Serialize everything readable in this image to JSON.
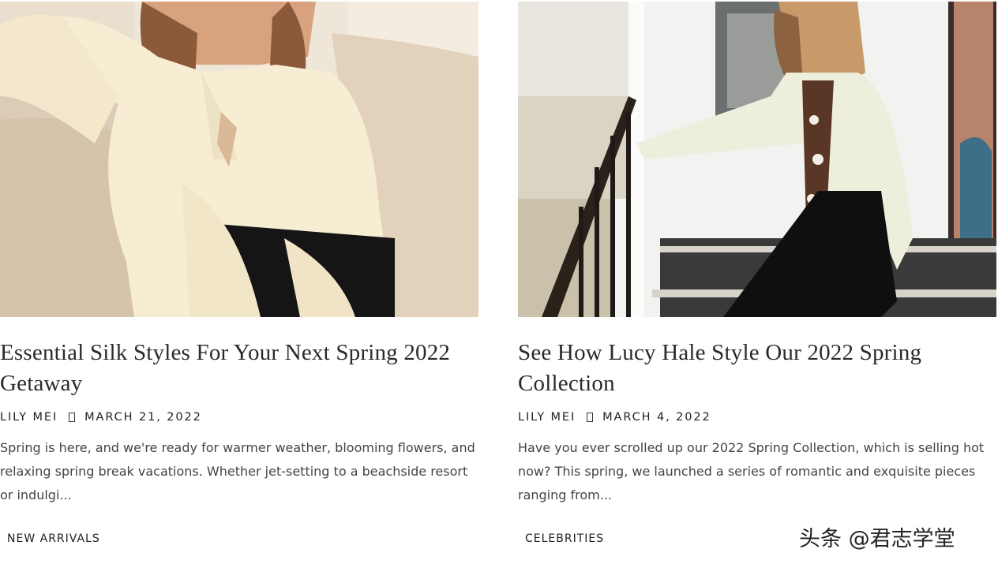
{
  "posts": [
    {
      "title": "Essential Silk Styles For Your Next Spring 2022 Getaway",
      "author": "LILY MEI",
      "date": "MARCH 21, 2022",
      "excerpt": "Spring is here, and we're ready for warmer weather, blooming flowers, and relaxing spring break vacations. Whether jet-setting to a beachside resort or indulgi...",
      "tag": "NEW ARRIVALS",
      "image_alt": "Model in a cream silk blouse seated on a beige sofa",
      "colors": {
        "background": "#efe6da",
        "sofa": "#dccbb6",
        "blouse": "#f6edd3",
        "hair": "#8a5a3a",
        "trousers": "#151515"
      }
    },
    {
      "title": "See How Lucy Hale Style Our 2022 Spring Collection",
      "author": "LILY MEI",
      "date": "MARCH 4, 2022",
      "excerpt": "Have you ever scrolled up our 2022 Spring Collection, which is selling hot now? This spring, we launched a series of romantic and exquisite pieces ranging from...",
      "tag": "CELEBRITIES",
      "image_alt": "Lucy Hale in a silk shirt with brown floral scarf on a staircase",
      "colors": {
        "wall": "#f2f2f0",
        "stairs": "#2d2d2d",
        "shirt": "#eeeedd",
        "scarf": "#5a3626",
        "skirt": "#0f0f0f"
      }
    }
  ],
  "watermark": "头条 @君志学堂"
}
